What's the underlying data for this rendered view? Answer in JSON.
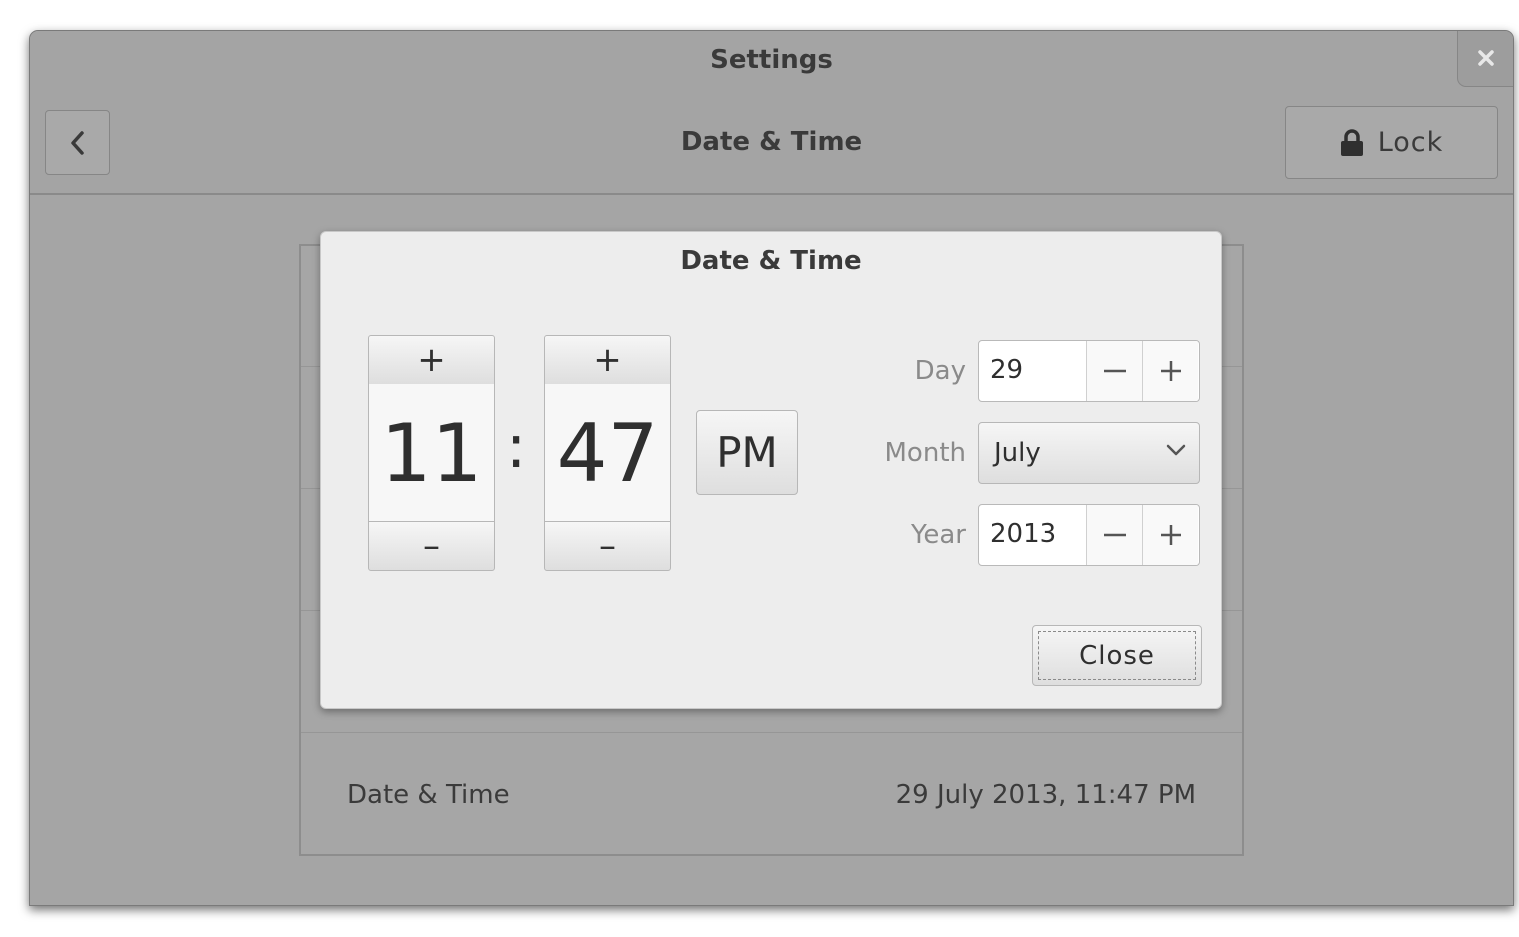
{
  "window": {
    "title": "Settings",
    "close_icon": "close-icon"
  },
  "header": {
    "back_icon": "chevron-left-icon",
    "title": "Date & Time",
    "lock_label": "Lock",
    "lock_icon": "lock-icon"
  },
  "panel": {
    "row_label": "Date & Time",
    "row_value": "29 July 2013, 11:47 PM"
  },
  "dialog": {
    "title": "Date & Time",
    "hour": "11",
    "minute": "47",
    "separator": ":",
    "ampm": "PM",
    "increment_symbol": "+",
    "decrement_symbol": "–",
    "day_label": "Day",
    "day_value": "29",
    "month_label": "Month",
    "month_value": "July",
    "year_label": "Year",
    "year_value": "2013",
    "close_label": "Close"
  },
  "colors": {
    "backdrop": "#a5a5a5",
    "dialog_bg": "#ededed",
    "text": "#3a3a3a",
    "label_muted": "#8a8a8a"
  }
}
